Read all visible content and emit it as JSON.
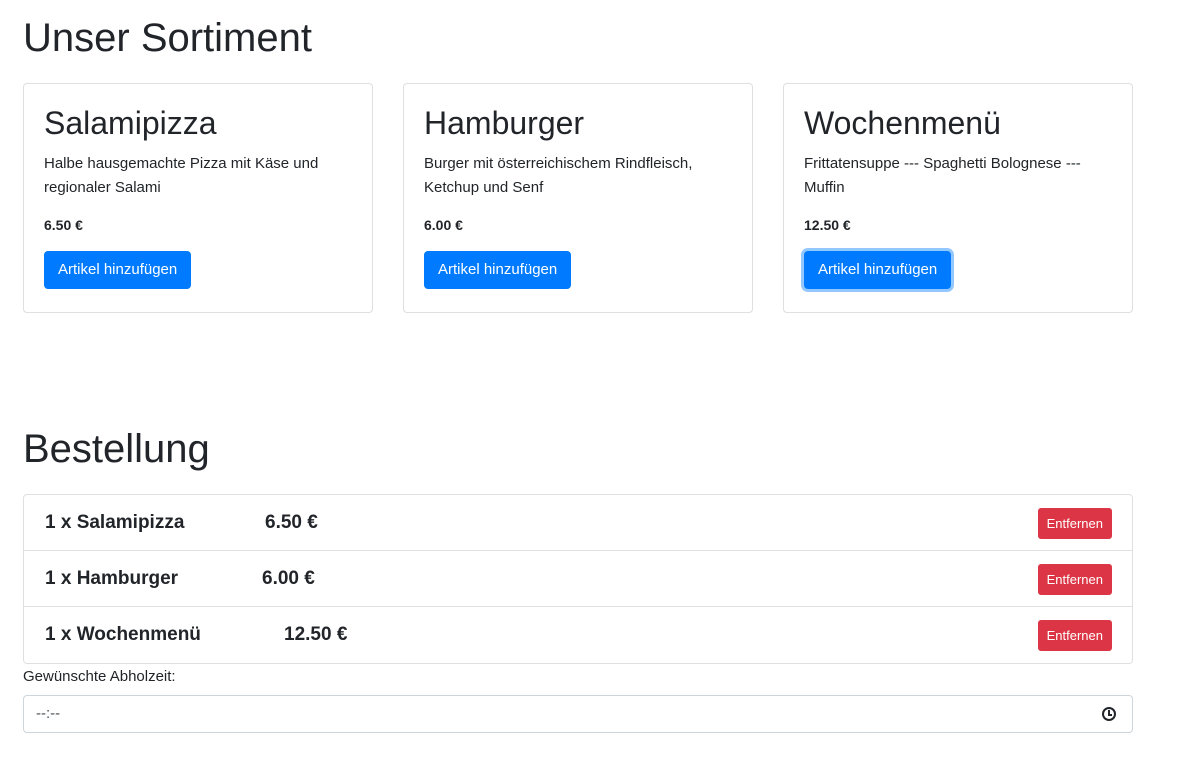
{
  "sortiment": {
    "title": "Unser Sortiment",
    "products": [
      {
        "name": "Salamipizza",
        "description": "Halbe hausgemachte Pizza mit Käse und regionaler Salami",
        "price": "6.50 €",
        "button_label": "Artikel hinzufügen"
      },
      {
        "name": "Hamburger",
        "description": "Burger mit österreichischem Rindfleisch, Ketchup und Senf",
        "price": "6.00 €",
        "button_label": "Artikel hinzufügen"
      },
      {
        "name": "Wochenmenü",
        "description": "Frittatensuppe --- Spaghetti Bolognese --- Muffin",
        "price": "12.50 €",
        "button_label": "Artikel hinzufügen"
      }
    ]
  },
  "bestellung": {
    "title": "Bestellung",
    "items": [
      {
        "label": "1 x Salamipizza",
        "price": "6.50 €",
        "remove_label": "Entfernen"
      },
      {
        "label": "1 x Hamburger",
        "price": "6.00 €",
        "remove_label": "Entfernen"
      },
      {
        "label": "1 x Wochenmenü",
        "price": "12.50 €",
        "remove_label": "Entfernen"
      }
    ],
    "pickup_label": "Gewünschte Abholzeit:",
    "pickup_value": "--:--",
    "pickup_icon": "clock-icon"
  },
  "colors": {
    "primary": "#007bff",
    "danger": "#dc3545",
    "text": "#212529"
  }
}
